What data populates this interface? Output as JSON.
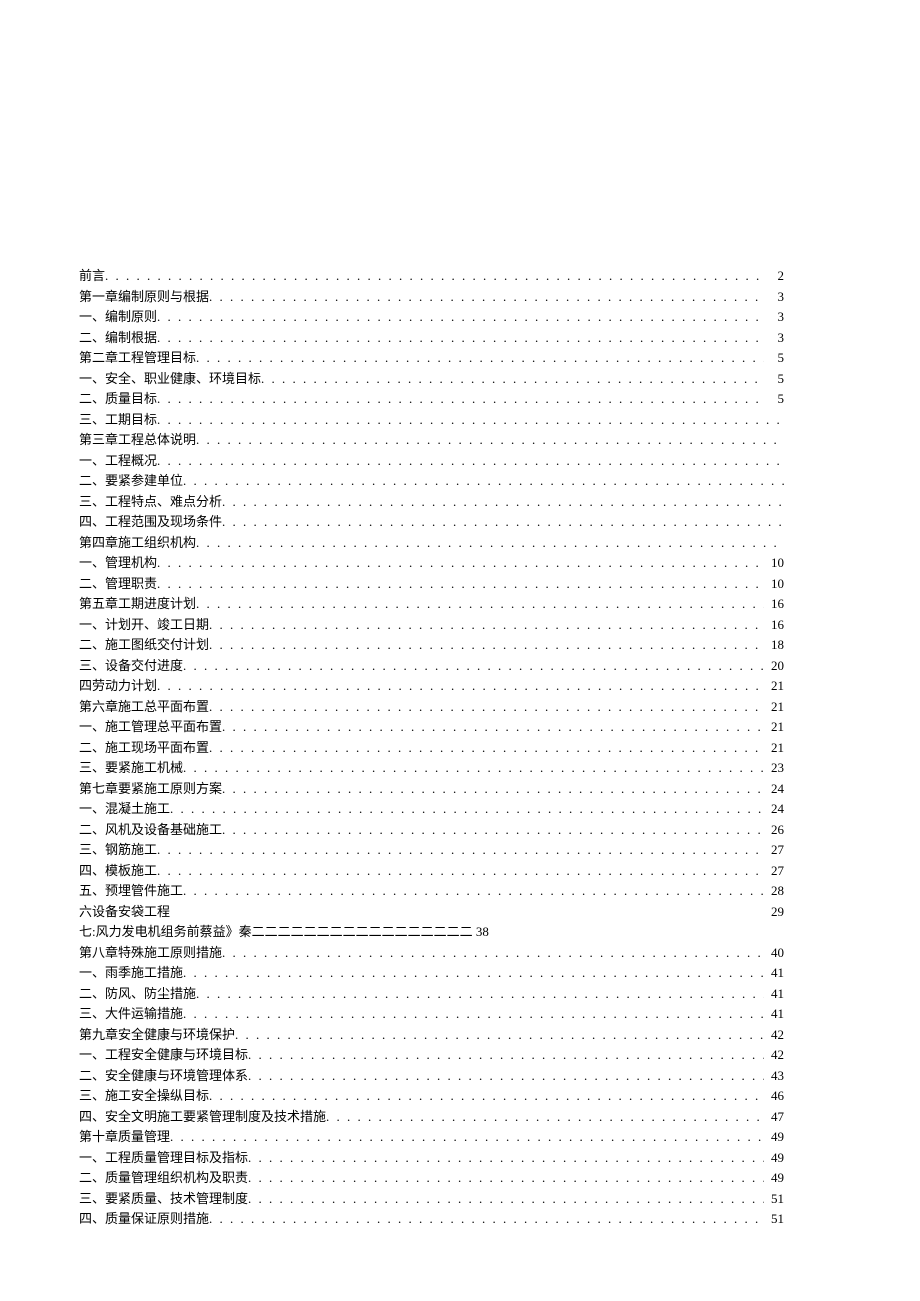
{
  "toc": [
    {
      "title": "前言",
      "page": "2",
      "style": ""
    },
    {
      "title": "第一章编制原则与根据",
      "page": "3",
      "style": ""
    },
    {
      "title": "一、编制原则",
      "page": "3",
      "style": ""
    },
    {
      "title": "二、编制根据",
      "page": "3",
      "style": ""
    },
    {
      "title": "第二章工程管理目标",
      "page": "5",
      "style": ""
    },
    {
      "title": "一、安全、职业健康、环境目标",
      "page": "5",
      "style": ""
    },
    {
      "title": "二、质量目标",
      "page": "5",
      "style": ""
    },
    {
      "title": "三、工期目标",
      "page": "",
      "style": "nopage"
    },
    {
      "title": "第三章工程总体说明",
      "page": "",
      "style": "nopage"
    },
    {
      "title": "一、工程概况",
      "page": "",
      "style": "nopage"
    },
    {
      "title": "二、要紧参建单位",
      "page": "",
      "style": "nopage"
    },
    {
      "title": "三、工程特点、难点分析",
      "page": "",
      "style": "nopage"
    },
    {
      "title": "四、工程范围及现场条件",
      "page": "",
      "style": "nopage"
    },
    {
      "title": "第四章施工组织机构",
      "page": "",
      "style": "nopage"
    },
    {
      "title": "一、管理机构",
      "page": "10",
      "style": ""
    },
    {
      "title": "二、管理职责",
      "page": "10",
      "style": ""
    },
    {
      "title": "第五章工期进度计划",
      "page": "16",
      "style": ""
    },
    {
      "title": "一、计划开、竣工日期",
      "page": "16",
      "style": ""
    },
    {
      "title": "二、施工图纸交付计划",
      "page": "18",
      "style": ""
    },
    {
      "title": "三、设备交付进度",
      "page": "20",
      "style": ""
    },
    {
      "title": "四劳动力计划",
      "page": "21",
      "style": ""
    },
    {
      "title": "第六章施工总平面布置",
      "page": "21",
      "style": ""
    },
    {
      "title": "一、施工管理总平面布置",
      "page": "21",
      "style": ""
    },
    {
      "title": "二、施工现场平面布置",
      "page": "21",
      "style": ""
    },
    {
      "title": "三、要紧施工机械",
      "page": "23",
      "style": ""
    },
    {
      "title": "第七章要紧施工原则方案",
      "page": "24",
      "style": ""
    },
    {
      "title": "一、混凝土施工",
      "page": "24",
      "style": ""
    },
    {
      "title": "二、风机及设备基础施工",
      "page": "26",
      "style": ""
    },
    {
      "title": "三、钢筋施工",
      "page": "27",
      "style": ""
    },
    {
      "title": "四、模板施工",
      "page": "27",
      "style": ""
    },
    {
      "title": "五、预埋管件施工",
      "page": "28",
      "style": ""
    },
    {
      "title": "六设备安袋工程",
      "page": "29",
      "style": "noleader"
    },
    {
      "title": "七:风力发电机组务前蔡益》秦二二二二二二二二二二二二二二二二二 38",
      "page": "",
      "style": "plain"
    },
    {
      "title": "第八章特殊施工原则措施",
      "page": "40",
      "style": ""
    },
    {
      "title": "一、雨季施工措施",
      "page": "41",
      "style": ""
    },
    {
      "title": "二、防风、防尘措施",
      "page": "41",
      "style": ""
    },
    {
      "title": "三、大件运输措施",
      "page": "41",
      "style": ""
    },
    {
      "title": "第九章安全健康与环境保护",
      "page": "42",
      "style": ""
    },
    {
      "title": "一、工程安全健康与环境目标",
      "page": "42",
      "style": ""
    },
    {
      "title": "二、安全健康与环境管理体系",
      "page": "43",
      "style": ""
    },
    {
      "title": "三、施工安全操纵目标",
      "page": "46",
      "style": ""
    },
    {
      "title": "四、安全文明施工要紧管理制度及技术措施",
      "page": "47",
      "style": ""
    },
    {
      "title": "第十章质量管理",
      "page": "49",
      "style": ""
    },
    {
      "title": "一、工程质量管理目标及指标",
      "page": "49",
      "style": ""
    },
    {
      "title": "二、质量管理组织机构及职责",
      "page": "49",
      "style": ""
    },
    {
      "title": "三、要紧质量、技术管理制度",
      "page": "51",
      "style": ""
    },
    {
      "title": "四、质量保证原则措施",
      "page": "51",
      "style": ""
    }
  ]
}
